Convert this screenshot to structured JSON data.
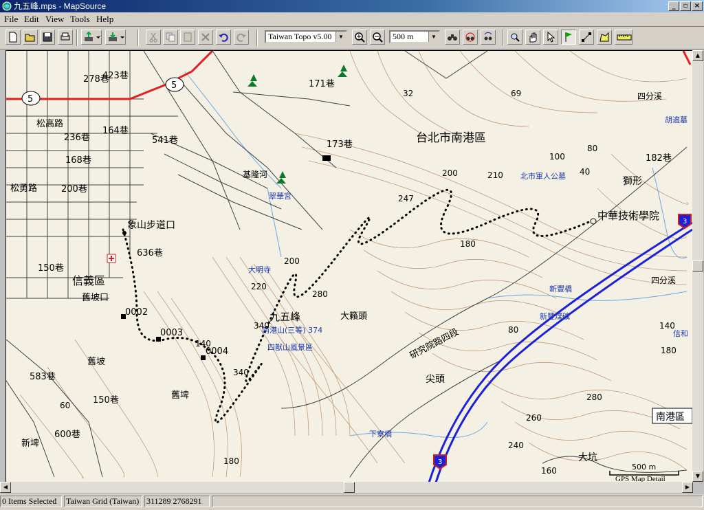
{
  "window": {
    "title": "九五峰.mps - MapSource",
    "controls": {
      "minimize": "_",
      "restore": "▫",
      "close": "×"
    }
  },
  "menu": [
    "File",
    "Edit",
    "View",
    "Tools",
    "Help"
  ],
  "toolbar": {
    "map_product": "Taiwan Topo v5.00",
    "zoom_scale": "500 m"
  },
  "map": {
    "district_labels": {
      "nangang": "台北市南港區",
      "xinyi": "信義區",
      "nangang_box": "南港區"
    },
    "places": {
      "xiangshan_trailhead": "象山步道口",
      "jiuwufeng": "九五峰",
      "zhonghua_institute": "中華技術學院",
      "dapo_top": "大籟頭",
      "jianshan": "尖頭",
      "dakeng": "大坑",
      "jiupo": "舊坡口",
      "jiupo2": "舊坡",
      "jiuzhuang": "舊埤",
      "xinzhuang": "新埤",
      "lion": "獅形",
      "songshan_rd": "松高路",
      "songyong_rd": "松勇路",
      "cuihua_temple": "翠華宮",
      "daming_temple": "大明寺",
      "keelung_river": "基隆河",
      "sishou_scenic": "四獸山風景區",
      "nangang_shan": "南港山(三等) 374",
      "north_cemetery": "北市軍人公墓",
      "xinfeng_bridge": "新豐橋",
      "xinfeng_coal": "新豐煤礦",
      "xiajing_bridge": "下寮橋",
      "research_rd4": "研究院路四段",
      "sifenxi": "四分溪",
      "sifen": "四分溪",
      "huzhi": "胡適墓",
      "xinhe": "信和"
    },
    "waypoints": [
      "0002",
      "0003",
      "0004"
    ],
    "elevations": [
      "247",
      "200",
      "210",
      "180",
      "100",
      "80",
      "40",
      "69",
      "32",
      "200",
      "220",
      "280",
      "340",
      "340",
      "140",
      "180",
      "260",
      "280",
      "240",
      "180",
      "160",
      "140",
      "60",
      "80"
    ],
    "lanes": [
      "278巷",
      "423巷",
      "236巷",
      "164巷",
      "541巷",
      "168巷",
      "200巷",
      "636巷",
      "150巷",
      "171巷",
      "173巷",
      "182巷",
      "600巷",
      "583巷",
      "150巷"
    ],
    "route_numbers": [
      "5",
      "5",
      "3",
      "3"
    ],
    "scalebar": {
      "label": "500 m",
      "credit": "GPS Map Detail"
    }
  },
  "status": {
    "selection": "0 Items Selected",
    "grid": "Taiwan Grid (Taiwan)",
    "coordinates": "311289 2768291"
  },
  "colors": {
    "map_bg": "#f4f1e4",
    "contour": "#b98a64",
    "road": "#404040",
    "highway": "#1c20d8",
    "red_road": "#e02020",
    "water": "#6aa8e0",
    "label_blue": "#1d38b0"
  }
}
